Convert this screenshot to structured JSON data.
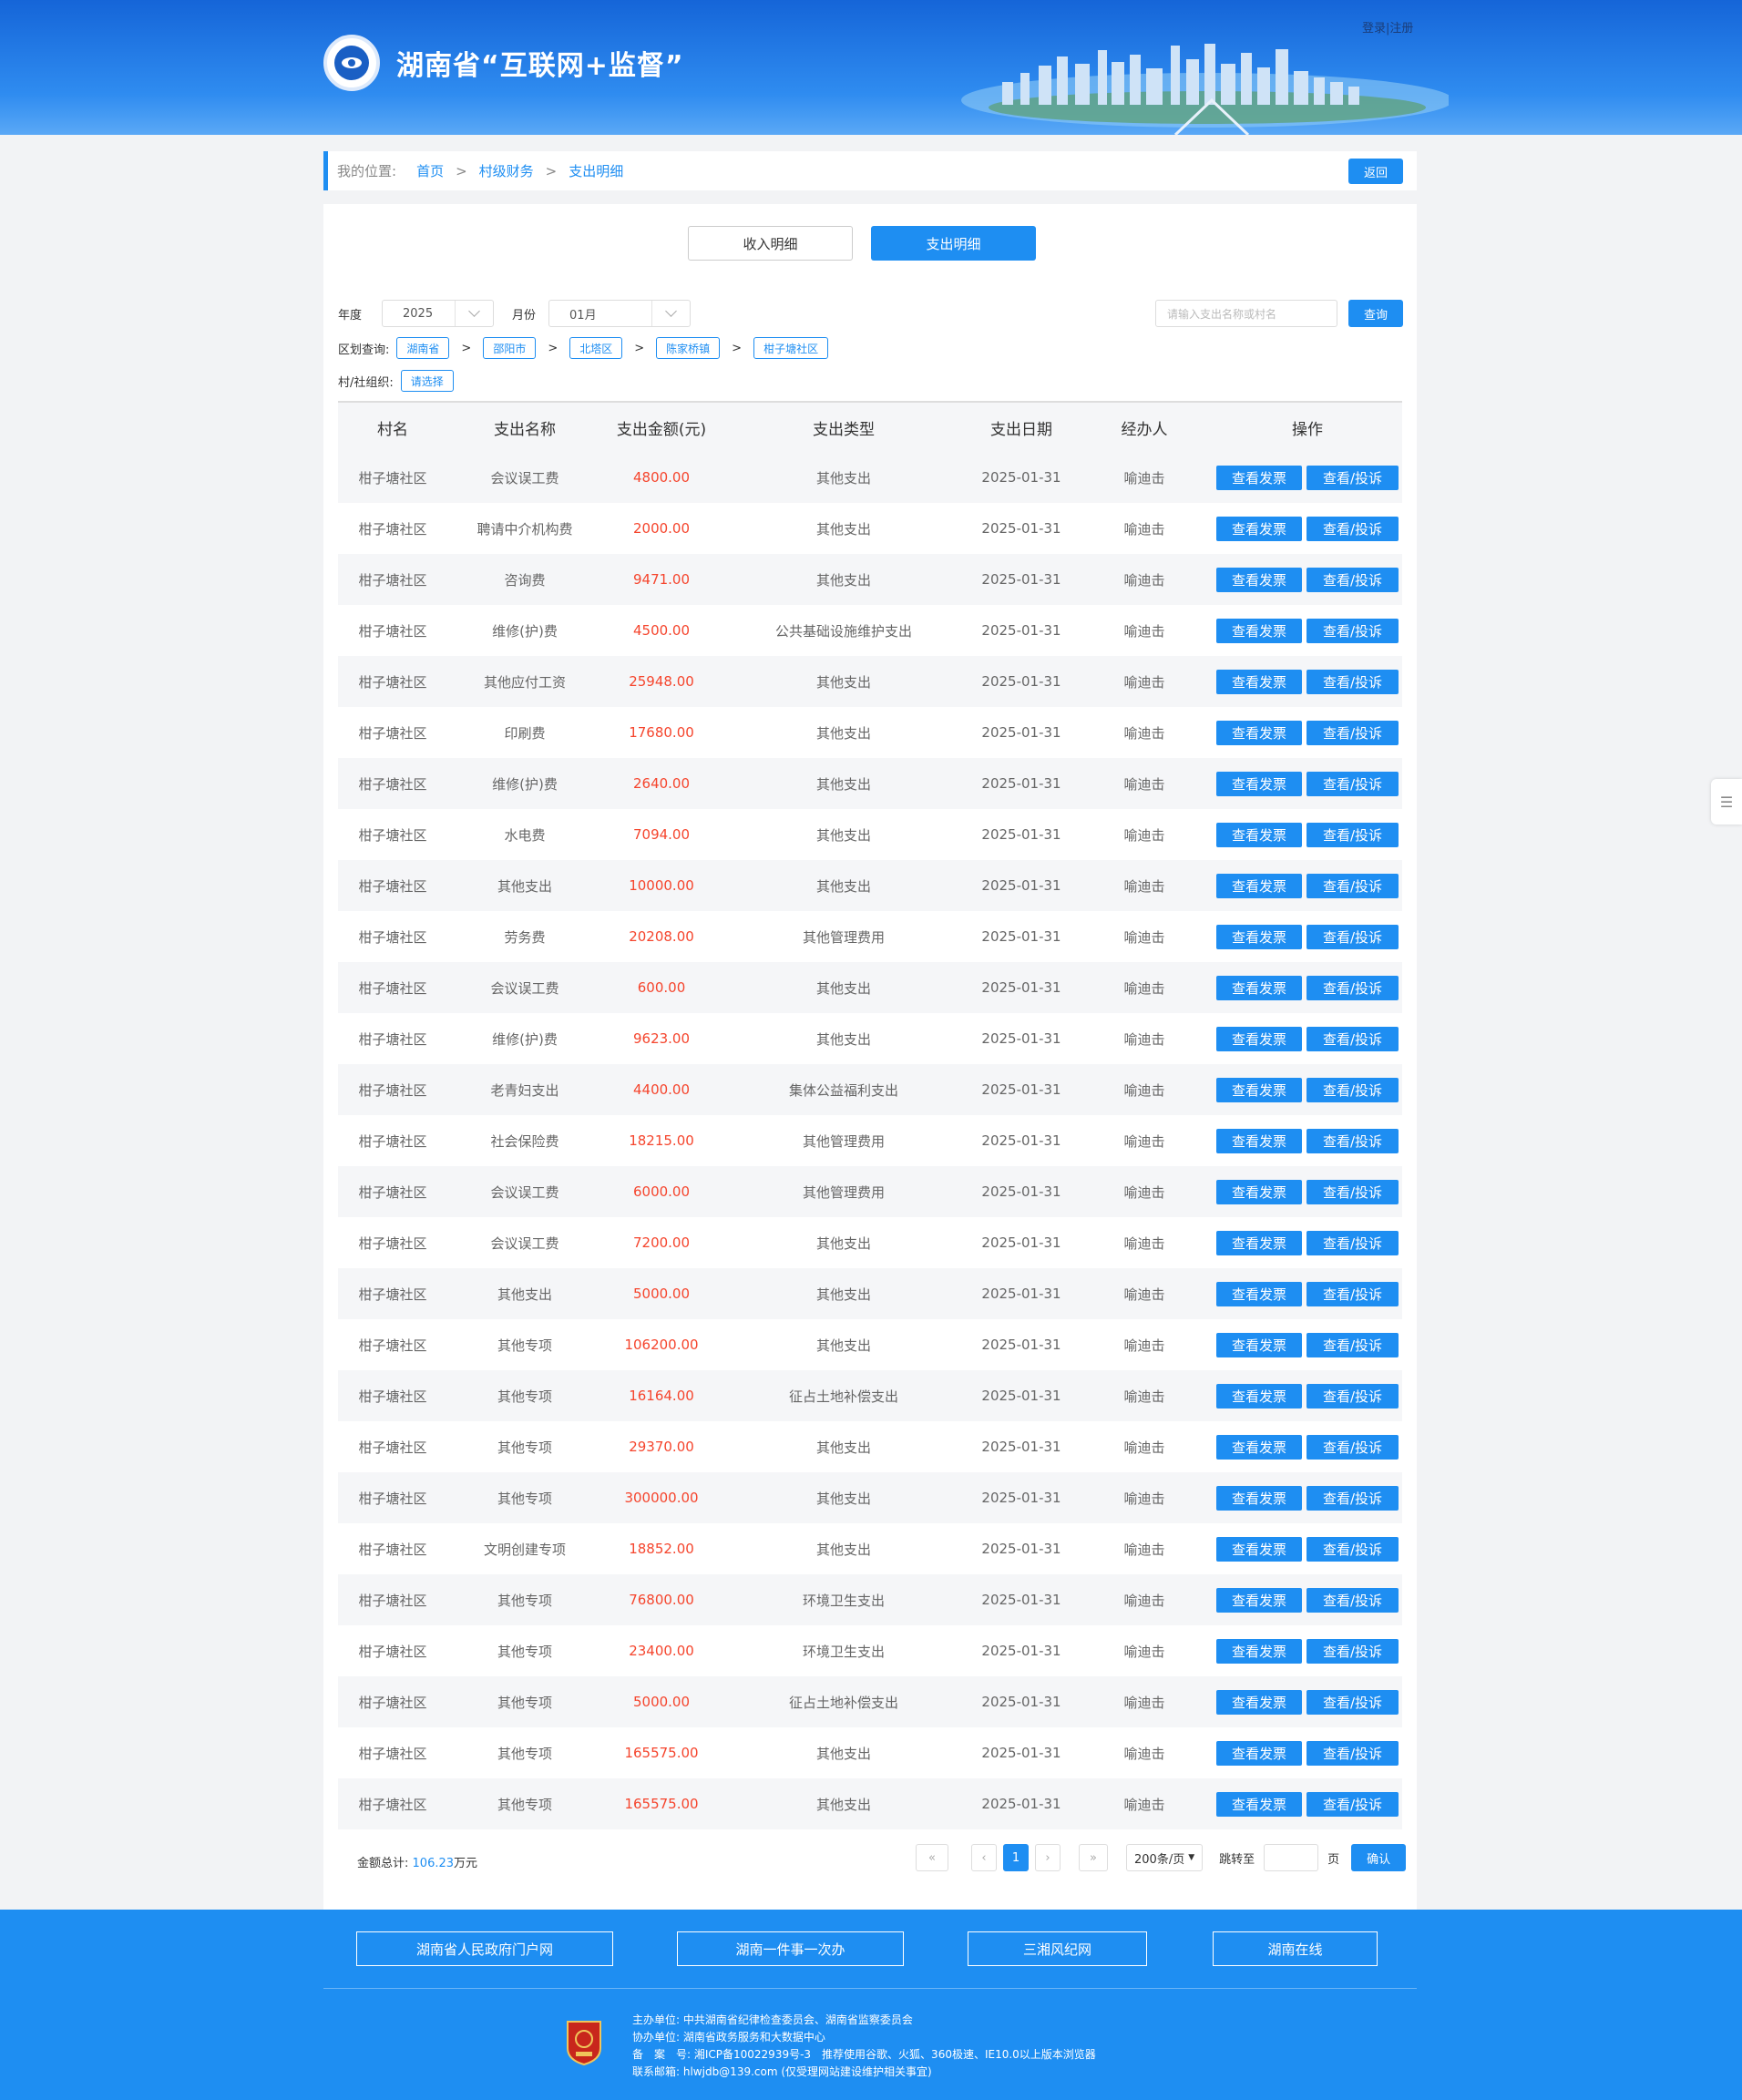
{
  "header": {
    "site_title": "湖南省“互联网+监督”",
    "login": "登录",
    "separator": "|",
    "register": "注册"
  },
  "breadcrumb": {
    "label": "我的位置:",
    "items": [
      "首页",
      "村级财务",
      "支出明细"
    ],
    "separator": ">",
    "back": "返回"
  },
  "tabs": {
    "income": "收入明细",
    "expense": "支出明细",
    "active": "支出明细"
  },
  "filters": {
    "year_label": "年度",
    "year_value": "2025",
    "month_label": "月份",
    "month_value": "01月",
    "search_placeholder": "请输入支出名称或村名",
    "search_button": "查询",
    "region_label": "区划查询:",
    "regions": [
      "湖南省",
      "邵阳市",
      "北塔区",
      "陈家桥镇",
      "柑子塘社区"
    ],
    "region_separator": ">",
    "org_label": "村/社组织:",
    "org_choose": "请选择"
  },
  "table": {
    "columns": [
      "村名",
      "支出名称",
      "支出金额(元)",
      "支出类型",
      "支出日期",
      "经办人",
      "操作"
    ],
    "action_invoice": "查看发票",
    "action_complaint": "查看/投诉",
    "rows": [
      [
        "柑子塘社区",
        "会议误工费",
        "4800.00",
        "其他支出",
        "2025-01-31",
        "喻迪击"
      ],
      [
        "柑子塘社区",
        "聘请中介机构费",
        "2000.00",
        "其他支出",
        "2025-01-31",
        "喻迪击"
      ],
      [
        "柑子塘社区",
        "咨询费",
        "9471.00",
        "其他支出",
        "2025-01-31",
        "喻迪击"
      ],
      [
        "柑子塘社区",
        "维修(护)费",
        "4500.00",
        "公共基础设施维护支出",
        "2025-01-31",
        "喻迪击"
      ],
      [
        "柑子塘社区",
        "其他应付工资",
        "25948.00",
        "其他支出",
        "2025-01-31",
        "喻迪击"
      ],
      [
        "柑子塘社区",
        "印刷费",
        "17680.00",
        "其他支出",
        "2025-01-31",
        "喻迪击"
      ],
      [
        "柑子塘社区",
        "维修(护)费",
        "2640.00",
        "其他支出",
        "2025-01-31",
        "喻迪击"
      ],
      [
        "柑子塘社区",
        "水电费",
        "7094.00",
        "其他支出",
        "2025-01-31",
        "喻迪击"
      ],
      [
        "柑子塘社区",
        "其他支出",
        "10000.00",
        "其他支出",
        "2025-01-31",
        "喻迪击"
      ],
      [
        "柑子塘社区",
        "劳务费",
        "20208.00",
        "其他管理费用",
        "2025-01-31",
        "喻迪击"
      ],
      [
        "柑子塘社区",
        "会议误工费",
        "600.00",
        "其他支出",
        "2025-01-31",
        "喻迪击"
      ],
      [
        "柑子塘社区",
        "维修(护)费",
        "9623.00",
        "其他支出",
        "2025-01-31",
        "喻迪击"
      ],
      [
        "柑子塘社区",
        "老青妇支出",
        "4400.00",
        "集体公益福利支出",
        "2025-01-31",
        "喻迪击"
      ],
      [
        "柑子塘社区",
        "社会保险费",
        "18215.00",
        "其他管理费用",
        "2025-01-31",
        "喻迪击"
      ],
      [
        "柑子塘社区",
        "会议误工费",
        "6000.00",
        "其他管理费用",
        "2025-01-31",
        "喻迪击"
      ],
      [
        "柑子塘社区",
        "会议误工费",
        "7200.00",
        "其他支出",
        "2025-01-31",
        "喻迪击"
      ],
      [
        "柑子塘社区",
        "其他支出",
        "5000.00",
        "其他支出",
        "2025-01-31",
        "喻迪击"
      ],
      [
        "柑子塘社区",
        "其他专项",
        "106200.00",
        "其他支出",
        "2025-01-31",
        "喻迪击"
      ],
      [
        "柑子塘社区",
        "其他专项",
        "16164.00",
        "征占土地补偿支出",
        "2025-01-31",
        "喻迪击"
      ],
      [
        "柑子塘社区",
        "其他专项",
        "29370.00",
        "其他支出",
        "2025-01-31",
        "喻迪击"
      ],
      [
        "柑子塘社区",
        "其他专项",
        "300000.00",
        "其他支出",
        "2025-01-31",
        "喻迪击"
      ],
      [
        "柑子塘社区",
        "文明创建专项",
        "18852.00",
        "其他支出",
        "2025-01-31",
        "喻迪击"
      ],
      [
        "柑子塘社区",
        "其他专项",
        "76800.00",
        "环境卫生支出",
        "2025-01-31",
        "喻迪击"
      ],
      [
        "柑子塘社区",
        "其他专项",
        "23400.00",
        "环境卫生支出",
        "2025-01-31",
        "喻迪击"
      ],
      [
        "柑子塘社区",
        "其他专项",
        "5000.00",
        "征占土地补偿支出",
        "2025-01-31",
        "喻迪击"
      ],
      [
        "柑子塘社区",
        "其他专项",
        "165575.00",
        "其他支出",
        "2025-01-31",
        "喻迪击"
      ],
      [
        "柑子塘社区",
        "其他专项",
        "165575.00",
        "其他支出",
        "2025-01-31",
        "喻迪击"
      ]
    ]
  },
  "summary": {
    "label": "金额总计:",
    "value": "106.23",
    "unit": "万元"
  },
  "pagination": {
    "current_page": "1",
    "page_size": "200条/页",
    "goto_label": "跳转至",
    "page_unit": "页",
    "confirm": "确认"
  },
  "footer": {
    "links": [
      "湖南省人民政府门户网",
      "湖南一件事一次办",
      "三湘风纪网",
      "湖南在线"
    ],
    "host": "主办单位: 中共湖南省纪律检查委员会、湖南省监察委员会",
    "co_host": "协办单位: 湖南省政务服务和大数据中心",
    "icp": "备　案　号: 湘ICP备10022939号-3　推荐使用谷歌、火狐、360极速、IE10.0以上版本浏览器",
    "email": "联系邮箱: hlwjdb@139.com (仅受理网站建设维护相关事宜)"
  },
  "colors": {
    "primary": "#1e8ef2",
    "amount": "#f5452d",
    "footer_bg": "#1e8ef2"
  }
}
